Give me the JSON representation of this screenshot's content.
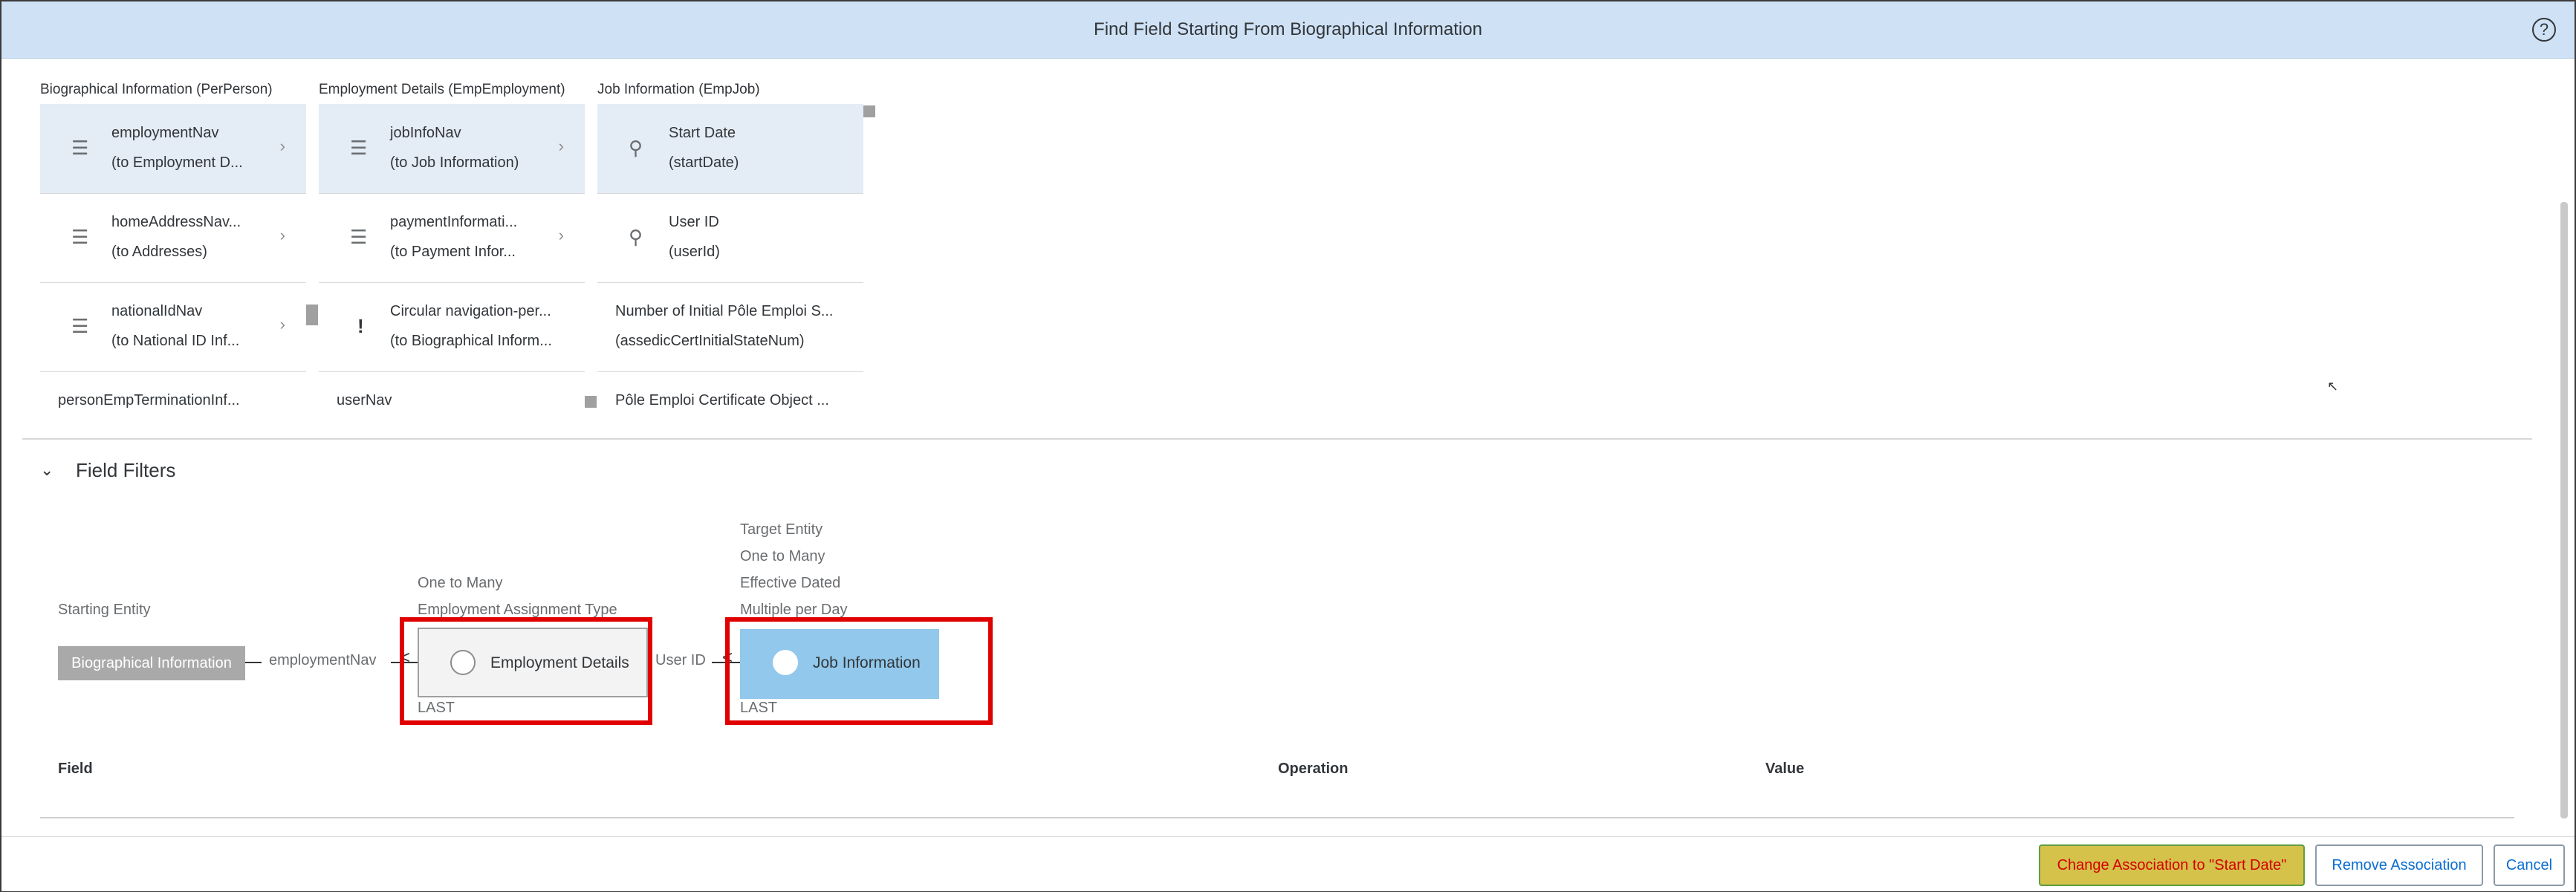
{
  "dialog": {
    "title": "Find Field Starting From Biographical Information",
    "help_icon": "?"
  },
  "columns": [
    {
      "header": "Biographical Information (PerPerson)",
      "tiles": [
        {
          "line1": "employmentNav",
          "line2": "(to Employment D...",
          "icon": "stack-icon"
        },
        {
          "line1": "homeAddressNav...",
          "line2": "(to Addresses)",
          "icon": "stack-icon"
        },
        {
          "line1": "nationalIdNav",
          "line2": "(to National ID Inf...",
          "icon": "stack-icon"
        },
        {
          "line1": "personEmpTerminationInf..."
        }
      ]
    },
    {
      "header": "Employment Details (EmpEmployment)",
      "tiles": [
        {
          "line1": "jobInfoNav",
          "line2": "(to Job Information)",
          "icon": "stack-icon"
        },
        {
          "line1": "paymentInformati...",
          "line2": "(to Payment Infor...",
          "icon": "stack-icon"
        },
        {
          "line1": "Circular navigation-per...",
          "line2": "(to Biographical Inform...",
          "icon": "!"
        },
        {
          "line1": "userNav"
        }
      ]
    },
    {
      "header": "Job Information (EmpJob)",
      "tiles": [
        {
          "line1": "Start Date",
          "line2": "(startDate)",
          "icon": "key-icon"
        },
        {
          "line1": "User ID",
          "line2": "(userId)",
          "icon": "key-icon"
        },
        {
          "line1": "Number of Initial Pôle Emploi S...",
          "line2": "(assedicCertInitialStateNum)"
        },
        {
          "line1": "Pôle Emploi Certificate Object ..."
        }
      ]
    }
  ],
  "field_filters": {
    "title": "Field Filters",
    "starting_entity_label": "Starting Entity",
    "starting_entity": "Biographical Information",
    "link1_label": "employmentNav",
    "emp_labels": [
      "One to Many",
      "Employment Assignment Type"
    ],
    "emp_entity": "Employment Details",
    "emp_last": "LAST",
    "link2_label": "User ID",
    "job_labels": [
      "Target Entity",
      "One to Many",
      "Effective Dated",
      "Multiple per Day"
    ],
    "job_entity": "Job Information",
    "job_last": "LAST"
  },
  "table": {
    "headers": [
      "Field",
      "Operation",
      "Value"
    ]
  },
  "footer": {
    "change_button": "Change Association to \"Start Date\"",
    "remove_button": "Remove Association",
    "cancel_button": "Cancel"
  },
  "colors": {
    "title_bar": "#cfe2f5",
    "selected_tile": "#e4ecf6",
    "job_entity": "#91c8eb",
    "highlight": "#e00000",
    "primary_button": "#d4c24a"
  }
}
